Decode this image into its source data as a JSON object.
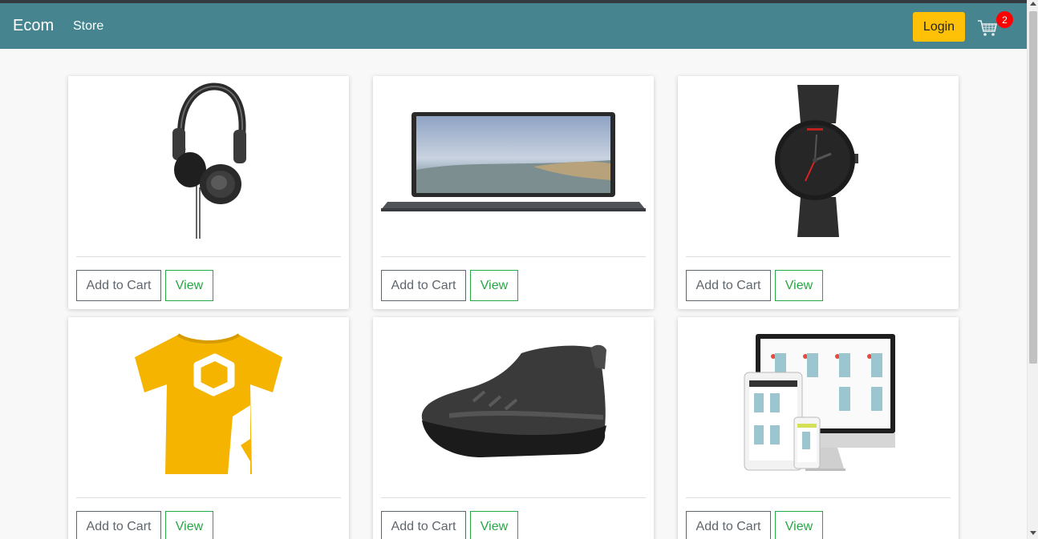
{
  "navbar": {
    "brand": "Ecom",
    "store_link": "Store",
    "login_label": "Login",
    "cart_count": "2",
    "color": "#468590"
  },
  "products": [
    {
      "image": "headphones-image",
      "add_label": "Add to Cart",
      "view_label": "View"
    },
    {
      "image": "laptop-image",
      "add_label": "Add to Cart",
      "view_label": "View"
    },
    {
      "image": "watch-image",
      "add_label": "Add to Cart",
      "view_label": "View"
    },
    {
      "image": "tshirt-image",
      "add_label": "Add to Cart",
      "view_label": "View"
    },
    {
      "image": "sneaker-image",
      "add_label": "Add to Cart",
      "view_label": "View"
    },
    {
      "image": "devices-storefront-image",
      "add_label": "Add to Cart",
      "view_label": "View"
    }
  ],
  "colors": {
    "login": "#fec107",
    "view_outline": "#28a745",
    "badge": "#ff0000"
  }
}
